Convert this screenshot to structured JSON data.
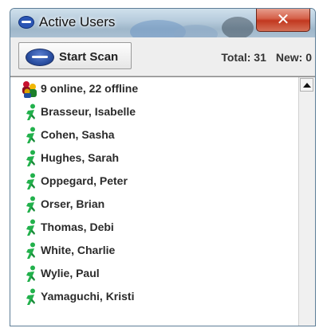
{
  "window": {
    "title": "Active Users",
    "close_glyph": "✕"
  },
  "toolbar": {
    "start_scan_label": "Start Scan",
    "total_label": "Total: 31",
    "new_label": "New: 0",
    "brand_icon": "respond-logo-icon"
  },
  "summary": {
    "text": "9 online, 22 offline",
    "icon": "users-group-icon"
  },
  "users": [
    {
      "name": "Brasseur, Isabelle",
      "icon": "online-person-icon"
    },
    {
      "name": "Cohen, Sasha",
      "icon": "online-person-icon"
    },
    {
      "name": "Hughes, Sarah",
      "icon": "online-person-icon"
    },
    {
      "name": "Oppegard, Peter",
      "icon": "online-person-icon"
    },
    {
      "name": "Orser, Brian",
      "icon": "online-person-icon"
    },
    {
      "name": "Thomas, Debi",
      "icon": "online-person-icon"
    },
    {
      "name": "White, Charlie",
      "icon": "online-person-icon"
    },
    {
      "name": "Wylie, Paul",
      "icon": "online-person-icon"
    },
    {
      "name": "Yamaguchi, Kristi",
      "icon": "online-person-icon"
    }
  ],
  "colors": {
    "online_green": "#22b14c",
    "titlebar": "#b5cadb",
    "close_red": "#c2381f"
  }
}
